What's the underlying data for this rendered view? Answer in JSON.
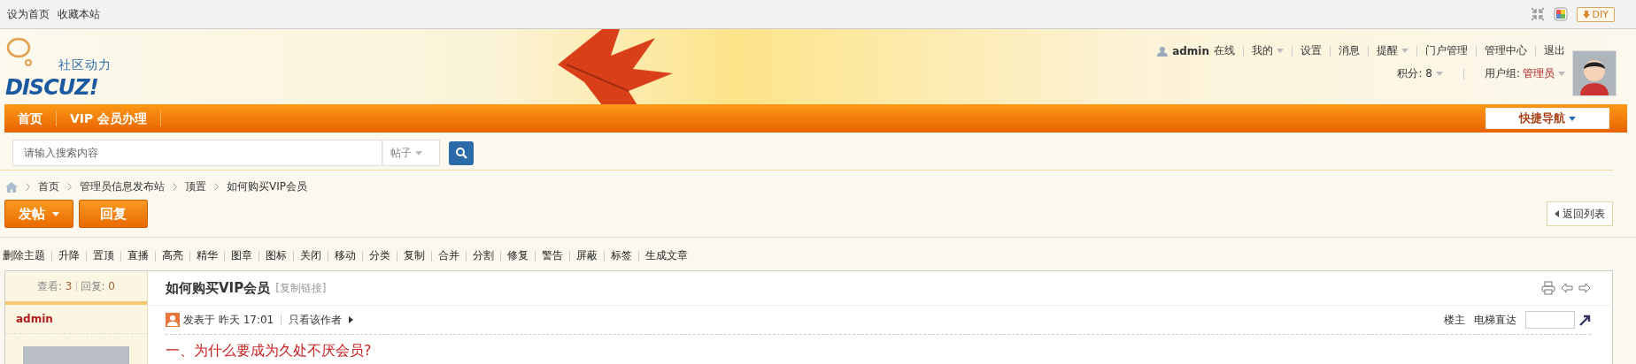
{
  "topbar": {
    "links": [
      "设为首页",
      "收藏本站"
    ],
    "diy_button": "DIY"
  },
  "logo": {
    "tagline": "社区动力",
    "wordmark": "DISCUZ!"
  },
  "user_menu": {
    "username": "admin",
    "status": "在线",
    "links": [
      {
        "label": "我的",
        "dropdown": true
      },
      {
        "label": "设置",
        "dropdown": false
      },
      {
        "label": "消息",
        "dropdown": false
      },
      {
        "label": "提醒",
        "dropdown": true
      },
      {
        "label": "门户管理",
        "dropdown": false
      },
      {
        "label": "管理中心",
        "dropdown": false
      },
      {
        "label": "退出",
        "dropdown": false
      }
    ]
  },
  "user_info": {
    "credits_label": "积分:",
    "credits": "8",
    "group_label": "用户组:",
    "group": "管理员"
  },
  "nav": {
    "items": [
      "首页",
      "VIP 会员办理"
    ],
    "quick_nav": "快捷导航"
  },
  "search": {
    "placeholder": "请输入搜索内容",
    "scope": "帖子"
  },
  "breadcrumb": [
    "首页",
    "管理员信息发布站",
    "顶置",
    "如何购买VIP会员"
  ],
  "actions": {
    "new_post": "发帖",
    "reply": "回复",
    "back": "返回列表"
  },
  "mod_actions": [
    "删除主题",
    "升降",
    "置顶",
    "直播",
    "高亮",
    "精华",
    "图章",
    "图标",
    "关闭",
    "移动",
    "分类",
    "复制",
    "合并",
    "分割",
    "修复",
    "警告",
    "屏蔽",
    "标签",
    "生成文章"
  ],
  "thread": {
    "views_label": "查看:",
    "views": "3",
    "replies_label": "回复:",
    "replies": "0",
    "title": "如何购买VIP会员",
    "copy_link": "[复制链接]"
  },
  "post": {
    "author": "admin",
    "posted": "发表于 昨天 17:01",
    "author_only": "只看该作者",
    "floor": "楼主",
    "jump_label": "电梯直达",
    "heading": "一、为什么要成为久处不厌会员?"
  }
}
